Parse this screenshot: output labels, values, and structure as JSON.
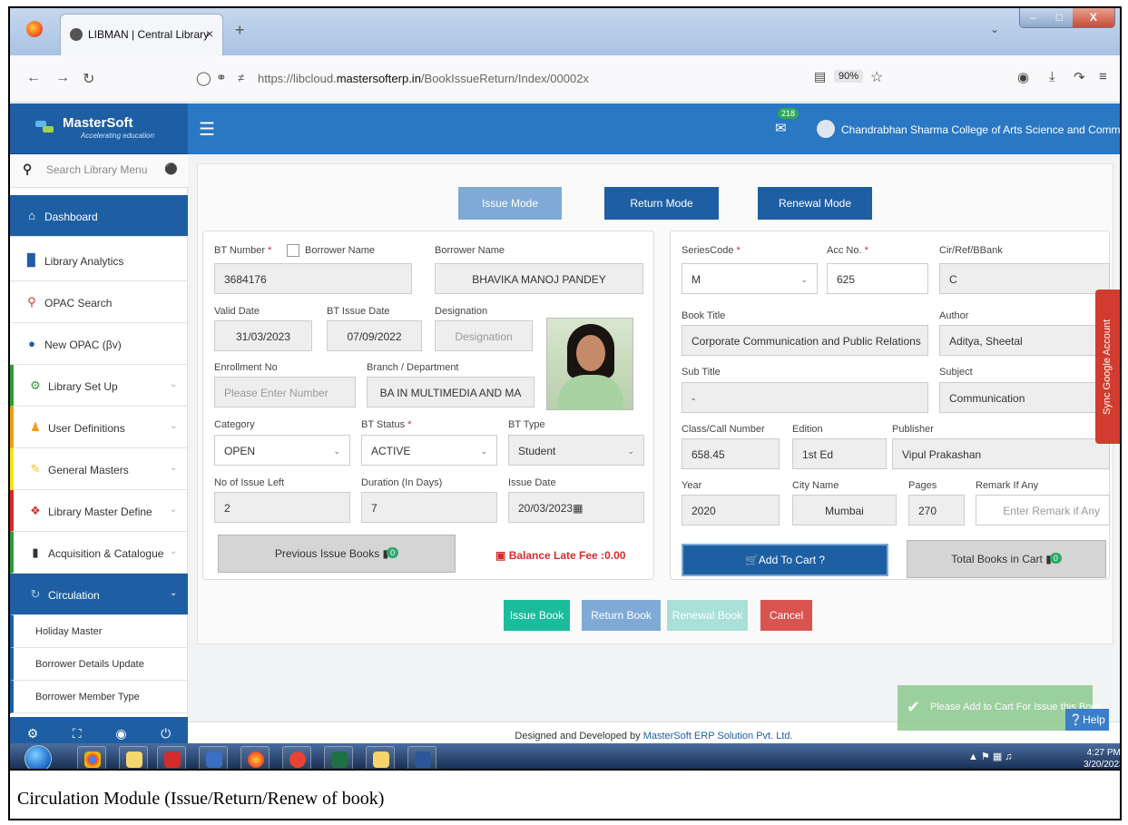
{
  "browser": {
    "tab_title": "LIBMAN | Central Library",
    "tab_close": "×",
    "new_tab": "+",
    "url_host_prefix": "https://libcloud.",
    "url_domain": "mastersofterp.in",
    "url_path": "/BookIssueReturn/Index/00002x",
    "zoom": "90%"
  },
  "brand": {
    "name": "MasterSoft",
    "tagline": "Accelerating education"
  },
  "header": {
    "mail_count": "218",
    "college": "Chandrabhan Sharma College of Arts Science and Commerce"
  },
  "sidebar": {
    "search_placeholder": "Search Library Menu",
    "items": [
      {
        "label": "Dashboard"
      },
      {
        "label": "Library Analytics"
      },
      {
        "label": "OPAC Search"
      },
      {
        "label": "New OPAC (βv)"
      },
      {
        "label": "Library Set Up"
      },
      {
        "label": "User Definitions"
      },
      {
        "label": "General Masters"
      },
      {
        "label": "Library Master Define"
      },
      {
        "label": "Acquisition & Catalogue"
      },
      {
        "label": "Circulation"
      }
    ],
    "subitems": [
      "Holiday Master",
      "Borrower Details Update",
      "Borrower Member Type"
    ]
  },
  "modes": {
    "issue": "Issue Mode",
    "return": "Return Mode",
    "renewal": "Renewal Mode"
  },
  "borrower": {
    "bt_number_label": "BT Number",
    "borrower_name_cb_label": "Borrower Name",
    "bt_number": "3684176",
    "borrower_name_label": "Borrower Name",
    "borrower_name": "BHAVIKA MANOJ PANDEY",
    "valid_date_label": "Valid Date",
    "valid_date": "31/03/2023",
    "bt_issue_date_label": "BT Issue Date",
    "bt_issue_date": "07/09/2022",
    "designation_label": "Designation",
    "designation_placeholder": "Designation",
    "enrollment_label": "Enrollment No",
    "enrollment_placeholder": "Please Enter Number",
    "branch_label": "Branch / Department",
    "branch": "BA IN MULTIMEDIA AND MA",
    "category_label": "Category",
    "category": "OPEN",
    "bt_status_label": "BT Status",
    "bt_status": "ACTIVE",
    "bt_type_label": "BT Type",
    "bt_type": "Student",
    "issue_left_label": "No of Issue Left",
    "issue_left": "2",
    "duration_label": "Duration (In Days)",
    "duration": "7",
    "issue_date_label": "Issue Date",
    "issue_date": "20/03/2023",
    "prev_issue_books": "Previous Issue Books",
    "prev_badge": "0",
    "late_fee": "Balance Late Fee :0.00"
  },
  "book": {
    "series_label": "SeriesCode",
    "series": "M",
    "acc_label": "Acc No.",
    "acc": "625",
    "cir_label": "Cir/Ref/BBank",
    "cir": "C",
    "title_label": "Book Title",
    "title": "Corporate Communication and Public Relations",
    "author_label": "Author",
    "author": "Aditya, Sheetal",
    "subtitle_label": "Sub Title",
    "subtitle": "-",
    "subject_label": "Subject",
    "subject": "Communication",
    "class_label": "Class/Call Number",
    "class_no": "658.45",
    "edition_label": "Edition",
    "edition": "1st Ed",
    "publisher_label": "Publisher",
    "publisher": "Vipul Prakashan",
    "year_label": "Year",
    "year": "2020",
    "city_label": "City Name",
    "city": "Mumbai",
    "pages_label": "Pages",
    "pages": "270",
    "remark_label": "Remark If Any",
    "remark_placeholder": "Enter Remark if Any",
    "add_to_cart": "Add To Cart ?",
    "total_in_cart": "Total Books in Cart",
    "cart_badge": "0"
  },
  "actions": {
    "issue": "Issue Book",
    "return": "Return Book",
    "renewal": "Renewal Book",
    "cancel": "Cancel"
  },
  "footer": {
    "prefix": "Designed and Developed by ",
    "company": "MasterSoft ERP Solution Pvt. Ltd."
  },
  "gsync": "Sync Google Account",
  "toast": "Please Add to Cart For Issue this Book.",
  "help": "Help",
  "clock": {
    "time": "4:27 PM",
    "date": "3/20/2023"
  },
  "caption": "Circulation Module (Issue/Return/Renew of book)",
  "colors": {
    "primary": "#1e5fa3",
    "header": "#2a77c4",
    "issue": "#1abc9c",
    "danger": "#d9534f"
  }
}
